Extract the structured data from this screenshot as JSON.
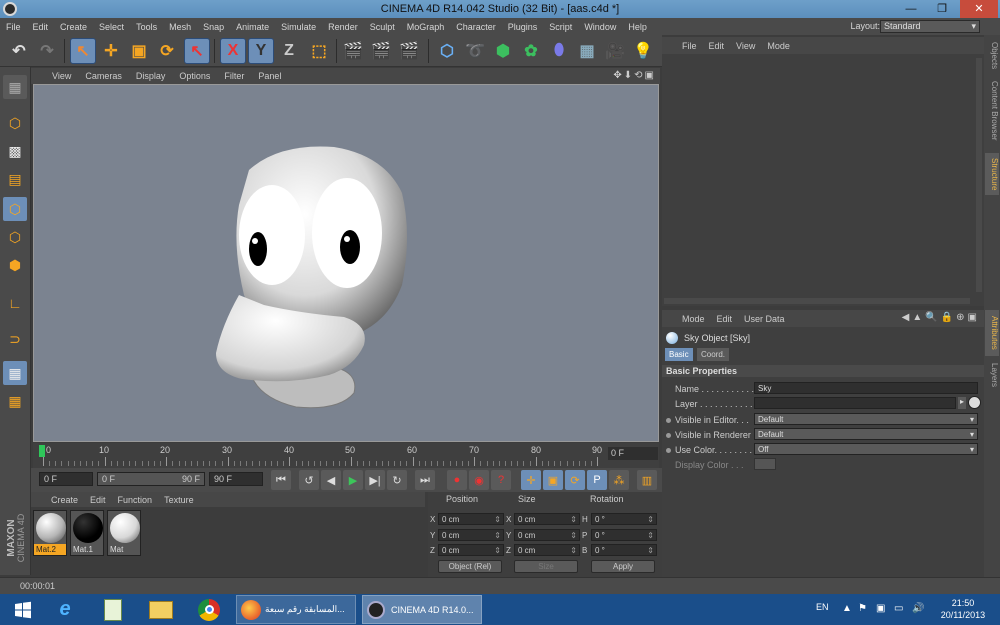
{
  "window": {
    "title": "CINEMA 4D R14.042 Studio (32 Bit) - [aas.c4d *]",
    "min": "—",
    "max": "❐",
    "close": "✕"
  },
  "menu": [
    "File",
    "Edit",
    "Create",
    "Select",
    "Tools",
    "Mesh",
    "Snap",
    "Animate",
    "Simulate",
    "Render",
    "Sculpt",
    "MoGraph",
    "Character",
    "Plugins",
    "Script",
    "Window",
    "Help"
  ],
  "layout": {
    "label": "Layout:",
    "value": "Standard"
  },
  "viewport": {
    "menu": [
      "View",
      "Cameras",
      "Display",
      "Options",
      "Filter",
      "Panel"
    ],
    "icons": "✥⬇⟲▣"
  },
  "timeline": {
    "ticks": [
      "0",
      "10",
      "20",
      "30",
      "40",
      "50",
      "60",
      "70",
      "80",
      "90"
    ],
    "current_frame": "0 F"
  },
  "transport": {
    "start": "0 F",
    "range_start": "0 F",
    "range_end": "90 F",
    "end": "90 F"
  },
  "materials": {
    "menu": [
      "Create",
      "Edit",
      "Function",
      "Texture"
    ],
    "items": [
      {
        "label": "Mat.2",
        "color": "#cfcfcf",
        "selected": true
      },
      {
        "label": "Mat.1",
        "color": "#000000",
        "selected": false
      },
      {
        "label": "Mat",
        "color": "#e8e8e8",
        "selected": false
      }
    ]
  },
  "coord": {
    "headers": [
      "Position",
      "Size",
      "Rotation"
    ],
    "rows": [
      {
        "a": "X",
        "pos": "0 cm",
        "b": "X",
        "size": "0 cm",
        "c": "H",
        "rot": "0 °"
      },
      {
        "a": "Y",
        "pos": "0 cm",
        "b": "Y",
        "size": "0 cm",
        "c": "P",
        "rot": "0 °"
      },
      {
        "a": "Z",
        "pos": "0 cm",
        "b": "Z",
        "size": "0 cm",
        "c": "B",
        "rot": "0 °"
      }
    ],
    "mode": "Object (Rel)",
    "size_mode": "Size",
    "apply": "Apply"
  },
  "status": "00:00:01",
  "objects": {
    "menu": [
      "File",
      "Edit",
      "View",
      "Mode"
    ]
  },
  "right_tabs": [
    "Objects",
    "Content Browser",
    "Structure",
    "Attributes",
    "Layers"
  ],
  "attributes": {
    "menu": [
      "Mode",
      "Edit",
      "User Data"
    ],
    "icons": "◀▲🔍🔒⊕▣",
    "object": "Sky Object [Sky]",
    "tabs": [
      "Basic",
      "Coord."
    ],
    "section": "Basic Properties",
    "props": [
      {
        "label": "Name . . . . . . . . . . . .",
        "value": "Sky"
      },
      {
        "label": "Layer . . . . . . . . . . . .",
        "value": ""
      },
      {
        "label": "Visible in Editor. . .",
        "value": "Default"
      },
      {
        "label": "Visible in Renderer",
        "value": "Default"
      },
      {
        "label": "Use Color. . . . . . . .",
        "value": "Off"
      },
      {
        "label": "Display Color . . .",
        "value": ""
      }
    ]
  },
  "taskbar": {
    "apps": [
      "المسابقة رقم سبعة...",
      "CINEMA 4D R14.0..."
    ],
    "lang": "EN",
    "time": "21:50",
    "date": "20/11/2013"
  }
}
